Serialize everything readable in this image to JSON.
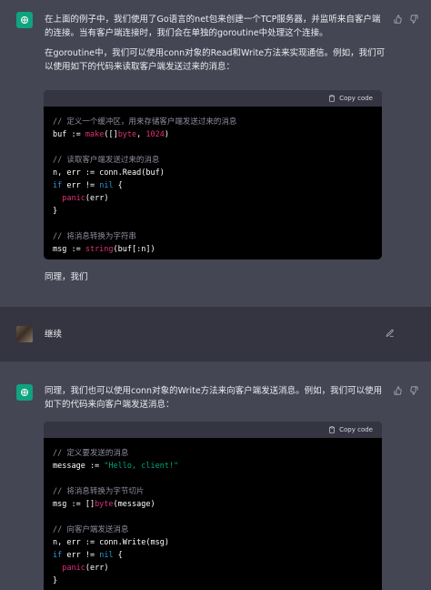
{
  "messages": {
    "first": {
      "paragraphs": [
        "在上面的例子中，我们使用了Go语言的net包来创建一个TCP服务器，并监听来自客户端的连接。当有客户端连接时，我们会在单独的goroutine中处理这个连接。",
        "在goroutine中，我们可以使用conn对象的Read和Write方法来实现通信。例如，我们可以使用如下的代码来读取客户端发送过来的消息："
      ],
      "copy_label": "Copy code",
      "code": {
        "c1": "// 定义一个缓冲区，用来存储客户端发送过来的消息",
        "l1_var": "buf",
        "l1_op": " := ",
        "l1_fn": "make",
        "l1_a": "([]",
        "l1_type": "byte",
        "l1_b": ", ",
        "l1_num": "1024",
        "l1_c": ")",
        "c2": "// 读取客户端发送过来的消息",
        "l2": "n, err := conn.Read(buf)",
        "l3_kw": "if",
        "l3_a": " err != ",
        "l3_nil": "nil",
        "l3_b": " {",
        "l4_fn": "panic",
        "l4_a": "(err)",
        "l5": "}",
        "c3": "// 将消息转换为字符串",
        "l6_a": "msg := ",
        "l6_fn": "string",
        "l6_b": "(buf[:n])"
      },
      "trailing": "同理，我们"
    },
    "user": {
      "text": "继续"
    },
    "second": {
      "paragraphs": [
        "同理，我们也可以使用conn对象的Write方法来向客户端发送消息。例如，我们可以使用如下的代码来向客户端发送消息："
      ],
      "copy_label": "Copy code",
      "code": {
        "c1": "// 定义要发送的消息",
        "l1_a": "message := ",
        "l1_str": "\"Hello, client!\"",
        "c2": "// 将消息转换为字节切片",
        "l2_a": "msg := []",
        "l2_type": "byte",
        "l2_b": "(message)",
        "c3": "// 向客户端发送消息",
        "l3": "n, err := conn.Write(msg)",
        "l4_kw": "if",
        "l4_a": " err != ",
        "l4_nil": "nil",
        "l4_b": " {",
        "l5_fn": "panic",
        "l5_a": "(err)",
        "l6": "}"
      }
    }
  },
  "icons": [
    "chatgpt-logo-icon",
    "thumbs-up-icon",
    "thumbs-down-icon",
    "clipboard-icon",
    "edit-icon"
  ],
  "colors": {
    "assistant_bg": "#444654",
    "user_bg": "#343541",
    "brand": "#10a37f",
    "code_bg": "#000000"
  }
}
